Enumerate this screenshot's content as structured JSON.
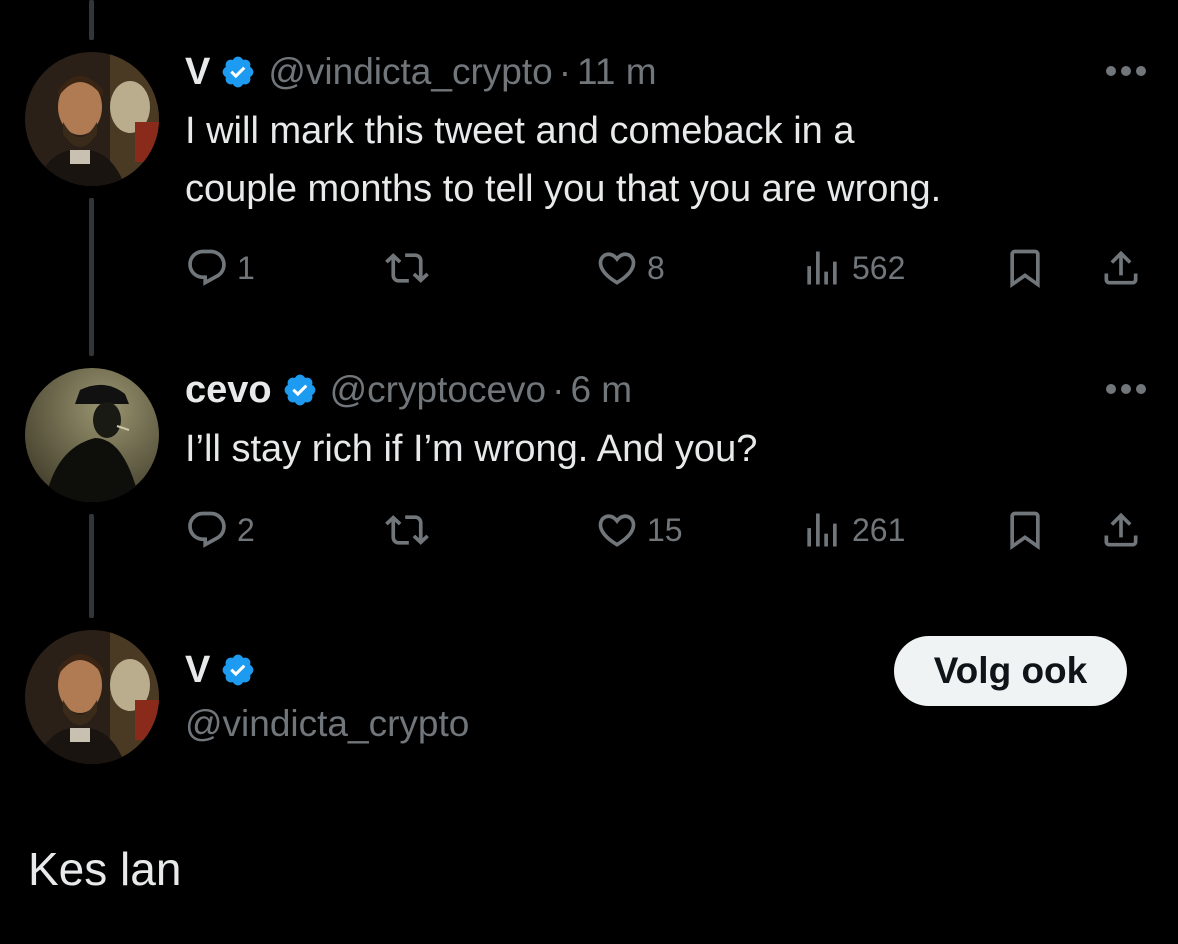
{
  "tweets": [
    {
      "name": "V",
      "handle": "@vindicta_crypto",
      "separator": "·",
      "time": "11 m",
      "text_line1": "I will mark this tweet and comeback in a",
      "text_line2": "couple months to tell you that you are wrong.",
      "replies": "1",
      "retweets": "",
      "likes": "8",
      "views": "562"
    },
    {
      "name": "cevo",
      "handle": "@cryptocevo",
      "separator": "·",
      "time": "6 m",
      "text_line1": "I’ll stay rich if I’m wrong. And you?",
      "replies": "2",
      "retweets": "",
      "likes": "15",
      "views": "261"
    }
  ],
  "focused": {
    "name": "V",
    "handle": "@vindicta_crypto",
    "follow_label": "Volg ook",
    "text": "Kes lan"
  },
  "colors": {
    "background": "#000000",
    "text": "#e7e9ea",
    "muted": "#71767b",
    "verified": "#1d9bf0",
    "thread_line": "#333639"
  },
  "icons": [
    "verified-badge-icon",
    "more-icon",
    "reply-icon",
    "retweet-icon",
    "like-icon",
    "views-icon",
    "bookmark-icon",
    "share-icon"
  ]
}
